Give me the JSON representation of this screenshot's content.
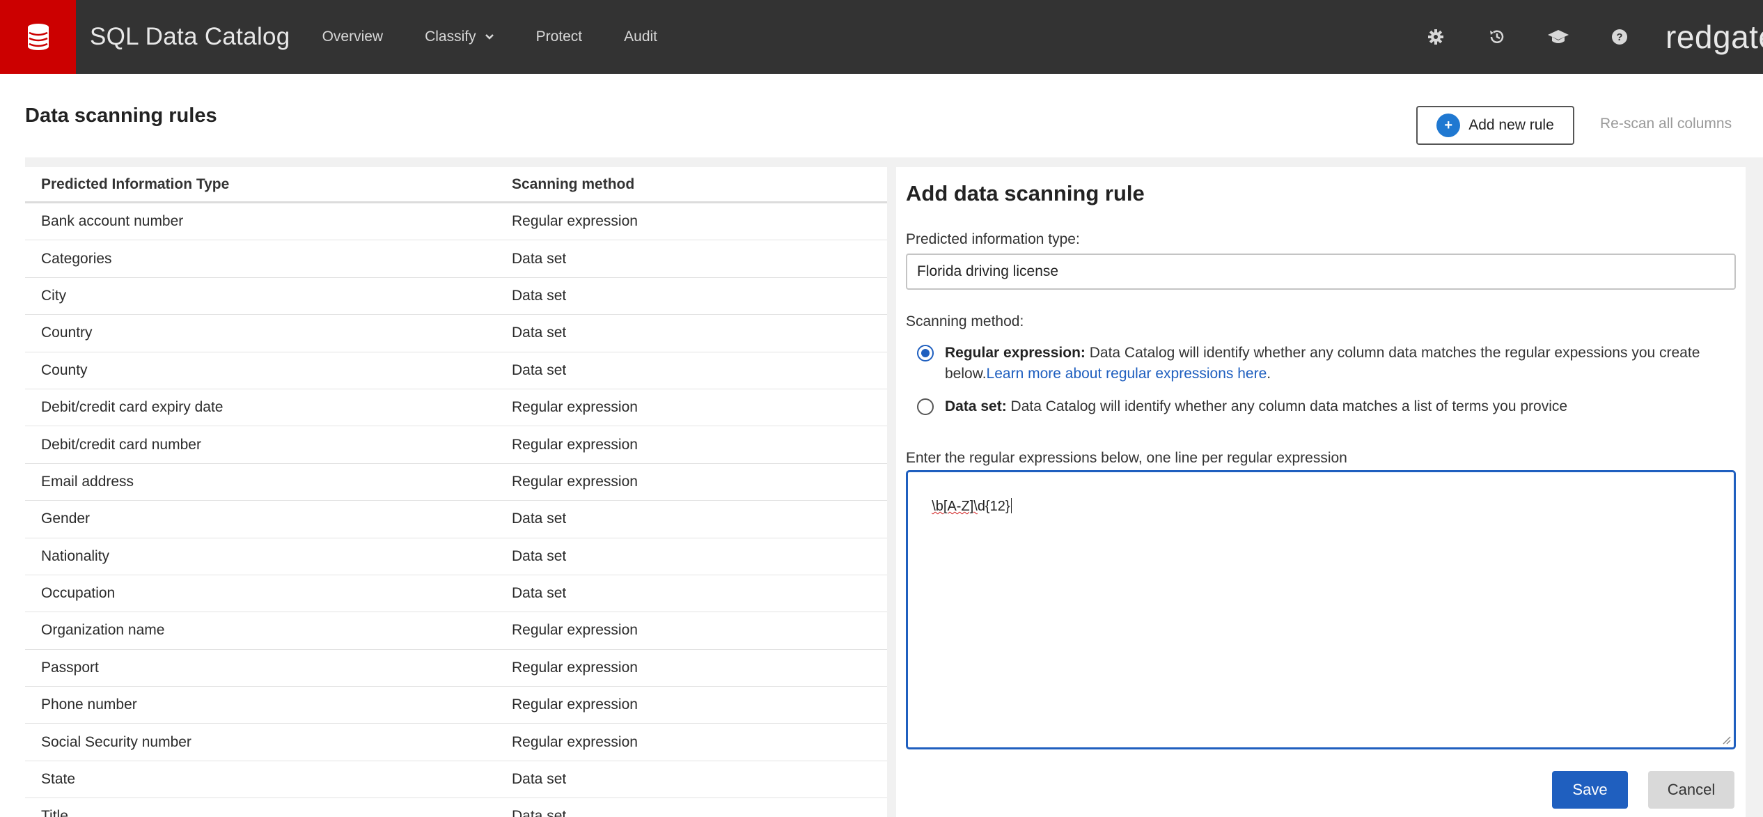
{
  "header": {
    "app_title": "SQL Data Catalog",
    "brand": "redgate",
    "logo_icon": "database-icon",
    "nav": [
      {
        "label": "Overview"
      },
      {
        "label": "Classify",
        "has_dropdown": true
      },
      {
        "label": "Protect"
      },
      {
        "label": "Audit"
      }
    ],
    "icons": [
      "gear-icon",
      "history-icon",
      "graduation-cap-icon",
      "help-icon"
    ]
  },
  "page": {
    "title": "Data scanning rules",
    "add_rule_label": "Add new rule",
    "rescan_label": "Re-scan all columns"
  },
  "table": {
    "columns": [
      "Predicted Information Type",
      "Scanning method"
    ],
    "rows": [
      {
        "type": "Bank account number",
        "method": "Regular expression"
      },
      {
        "type": "Categories",
        "method": "Data set"
      },
      {
        "type": "City",
        "method": "Data set"
      },
      {
        "type": "Country",
        "method": "Data set"
      },
      {
        "type": "County",
        "method": "Data set"
      },
      {
        "type": "Debit/credit card expiry date",
        "method": "Regular expression"
      },
      {
        "type": "Debit/credit card number",
        "method": "Regular expression"
      },
      {
        "type": "Email address",
        "method": "Regular expression"
      },
      {
        "type": "Gender",
        "method": "Data set"
      },
      {
        "type": "Nationality",
        "method": "Data set"
      },
      {
        "type": "Occupation",
        "method": "Data set"
      },
      {
        "type": "Organization name",
        "method": "Regular expression"
      },
      {
        "type": "Passport",
        "method": "Regular expression"
      },
      {
        "type": "Phone number",
        "method": "Regular expression"
      },
      {
        "type": "Social Security number",
        "method": "Regular expression"
      },
      {
        "type": "State",
        "method": "Data set"
      },
      {
        "type": "Title",
        "method": "Data set"
      }
    ]
  },
  "form": {
    "title": "Add data scanning rule",
    "type_label": "Predicted information type:",
    "type_value": "Florida driving license",
    "method_label": "Scanning method:",
    "regex_option": {
      "title": "Regular expression:",
      "text": " Data Catalog will identify whether any column data matches the regular expessions you create below.",
      "link": "Learn more about regular expressions here",
      "link_suffix": ".",
      "selected": true
    },
    "dataset_option": {
      "title": "Data set:",
      "text": " Data Catalog will identify whether any column data matches a list of terms you provice",
      "selected": false
    },
    "regex_label": "Enter the regular expressions below, one line per regular expression",
    "regex_value_misspelled": "\\b[A-Z]\\",
    "regex_value_rest": "d{12}",
    "save_label": "Save",
    "cancel_label": "Cancel"
  },
  "colors": {
    "topbar": "#333333",
    "logo": "#cc0000",
    "accent": "#1f5fbf",
    "add_button_icon": "#1f78d1"
  }
}
